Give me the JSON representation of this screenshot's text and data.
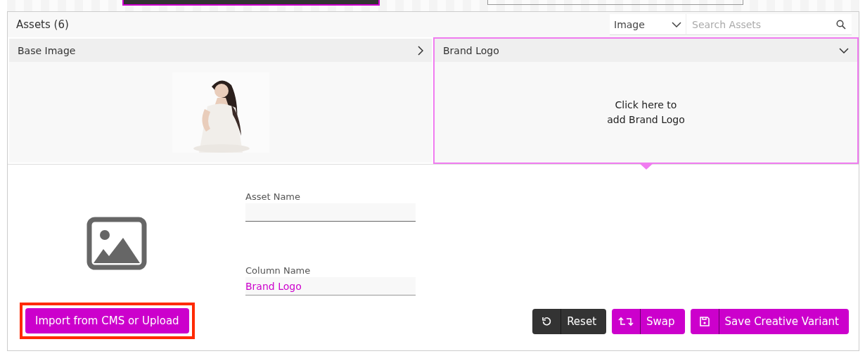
{
  "header": {
    "title": "Assets (6)",
    "type_select": {
      "value": "Image"
    },
    "search": {
      "placeholder": "Search Assets"
    }
  },
  "assets": [
    {
      "name": "Base Image",
      "selected": false,
      "expanded": false,
      "kind": "picture"
    },
    {
      "name": "Brand Logo",
      "selected": true,
      "expanded": true,
      "kind": "empty",
      "prompt": "Click here to\nadd Brand Logo"
    }
  ],
  "form": {
    "fields": [
      {
        "label": "Asset Name"
      },
      {
        "label": "Column Name",
        "value": "Brand Logo"
      }
    ]
  },
  "import_button": {
    "label": "Import from CMS or Upload",
    "highlighted": true
  },
  "actions": [
    {
      "label": "Reset",
      "kind": "reset"
    },
    {
      "label": "Swap",
      "kind": "swap"
    },
    {
      "label": "Save Creative Variant",
      "kind": "save"
    }
  ]
}
